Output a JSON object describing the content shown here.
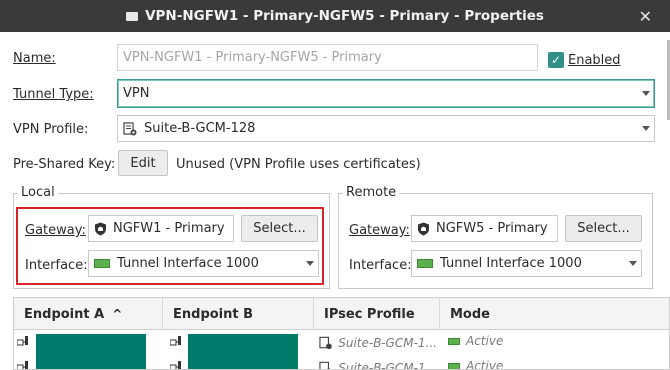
{
  "window": {
    "title": "VPN-NGFW1 - Primary-NGFW5 - Primary - Properties",
    "close_glyph": "✕"
  },
  "form": {
    "name_label": "Name:",
    "name_value": "VPN-NGFW1 - Primary-NGFW5 - Primary",
    "enabled_label": "Enabled",
    "enabled_checked": true,
    "tunnel_type_label": "Tunnel Type:",
    "tunnel_type_value": "VPN",
    "vpn_profile_label": "VPN Profile:",
    "vpn_profile_value": "Suite-B-GCM-128",
    "psk_label": "Pre-Shared Key:",
    "psk_edit_button": "Edit",
    "psk_status": "Unused (VPN Profile uses certificates)"
  },
  "local": {
    "title": "Local",
    "gateway_label": "Gateway:",
    "gateway_value": "NGFW1 - Primary",
    "select_button": "Select...",
    "interface_label": "Interface:",
    "interface_value": "Tunnel Interface 1000"
  },
  "remote": {
    "title": "Remote",
    "gateway_label": "Gateway:",
    "gateway_value": "NGFW5 - Primary",
    "select_button": "Select...",
    "interface_label": "Interface:",
    "interface_value": "Tunnel Interface 1000"
  },
  "table": {
    "columns": [
      "Endpoint A",
      "Endpoint B",
      "IPsec Profile",
      "Mode"
    ],
    "sort_indicator": "^",
    "rows": [
      {
        "ipsec_profile": "Suite-B-GCM-1...",
        "mode": "Active"
      },
      {
        "ipsec_profile": "Suite-B-GCM-1...",
        "mode": "Active"
      }
    ]
  },
  "colors": {
    "accent_teal": "#2f8f86",
    "endpoint_fill": "#007a6a",
    "highlight_red": "#d8232a",
    "active_green": "#5bb24d"
  },
  "icons": [
    "window-icon",
    "close-icon",
    "checkbox-checked-icon",
    "vpn-profile-icon",
    "gateway-shield-icon",
    "tunnel-interface-icon",
    "endpoint-icon",
    "sort-ascending-icon",
    "active-mode-icon"
  ]
}
